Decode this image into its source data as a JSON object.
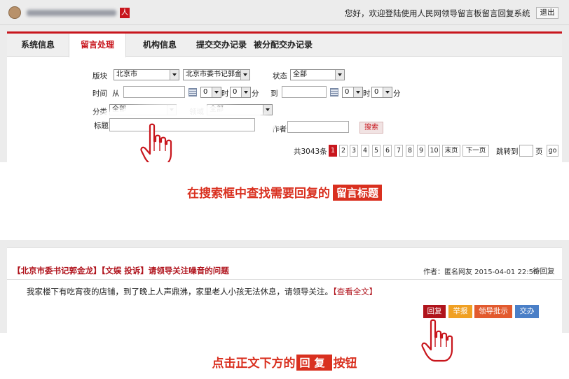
{
  "header": {
    "logo_char": "人",
    "welcome_text": "您好，欢迎登陆使用人民网领导留言板留言回复系统",
    "logout_label": "退出"
  },
  "tabs": [
    {
      "label": "系统信息"
    },
    {
      "label": "留言处理",
      "active": true
    },
    {
      "label": "机构信息"
    },
    {
      "label": "提交交办记录"
    },
    {
      "label": "被分配交办记录"
    }
  ],
  "filters": {
    "section_label": "版块",
    "section_value": "北京市",
    "target_value": "北京市委书记郭金",
    "status_label": "状态",
    "status_value": "全部",
    "time_label": "时间",
    "from_label": "从",
    "to_label": "到",
    "hour_value": "0",
    "hour_unit": "时",
    "minute_value": "0",
    "minute_unit": "分",
    "category_label": "分类",
    "category_value": "全部",
    "domain_label": "领域",
    "domain_value": "全部",
    "title_label": "标题",
    "title_value": "",
    "author_label": "作者",
    "author_value": "",
    "search_label": "搜索"
  },
  "pagination": {
    "total_text": "共3043条",
    "pages": [
      "1",
      "2",
      "3",
      "4",
      "5",
      "6",
      "7",
      "8",
      "9",
      "10"
    ],
    "current_page": "1",
    "last_label": "末页",
    "next_label": "下一页",
    "jump_label": "跳转到",
    "page_unit": "页",
    "go_label": "go"
  },
  "captions": {
    "step1_text": "在搜索框中查找需要回复的",
    "step1_tag": "留言标题",
    "step2_before": "点击正文下方的",
    "step2_tag": "回复",
    "step2_after": "按钮"
  },
  "message": {
    "title": "【北京市委书记郭金龙】【文娱 投诉】请领导关注噪音的问题",
    "meta": "作者：匿名网友 2015-04-01 22:56",
    "status": "待回复",
    "body": "我家楼下有吃宵夜的店铺，到了晚上人声鼎沸，家里老人小孩无法休息，请领导关注。",
    "more_label": "【查看全文】",
    "actions": {
      "reply": "回复",
      "report": "举报",
      "leader_review": "领导批示",
      "assign": "交办"
    }
  },
  "colors": {
    "brand_red": "#c8161d",
    "caption_red": "#d9301f",
    "reply_btn": "#b0141c",
    "report_btn": "#f0a023",
    "leader_btn": "#e25a2e",
    "assign_btn": "#4a7fc7"
  }
}
